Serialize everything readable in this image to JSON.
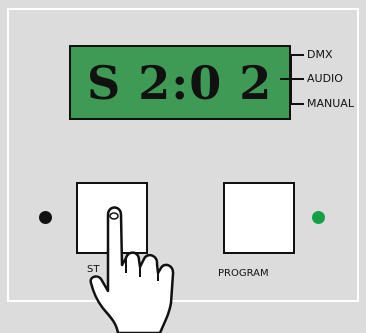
{
  "display": {
    "text": "S 2:0 2"
  },
  "modes": [
    {
      "label": "DMX"
    },
    {
      "label": "AUDIO"
    },
    {
      "label": "MANUAL"
    }
  ],
  "buttons": {
    "left": {
      "label": "ST"
    },
    "right": {
      "label": "PROGRAM"
    }
  },
  "indicators": {
    "left_led_color": "#111111",
    "right_led_color": "#14a046"
  },
  "colors": {
    "panel": "#dcdcdc",
    "lcd": "#3f9a55"
  }
}
